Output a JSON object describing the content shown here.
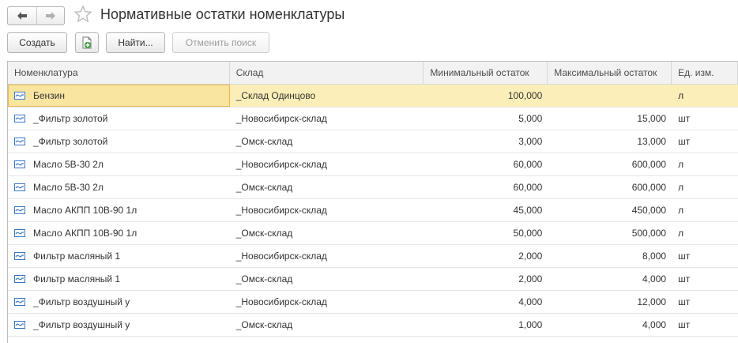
{
  "window": {
    "title": "Нормативные остатки номенклатуры"
  },
  "toolbar": {
    "create_label": "Создать",
    "find_label": "Найти...",
    "cancel_search_label": "Отменить поиск"
  },
  "table": {
    "columns": [
      "Номенклатура",
      "Склад",
      "Минимальный остаток",
      "Максимальный остаток",
      "Ед. изм."
    ],
    "rows": [
      {
        "name": "Бензин",
        "warehouse": "_Склад Одинцово",
        "min": "100,000",
        "max": "",
        "unit": "л",
        "selected": true
      },
      {
        "name": "_Фильтр золотой",
        "warehouse": "_Новосибирск-склад",
        "min": "5,000",
        "max": "15,000",
        "unit": "шт"
      },
      {
        "name": "_Фильтр золотой",
        "warehouse": "_Омск-склад",
        "min": "3,000",
        "max": "13,000",
        "unit": "шт"
      },
      {
        "name": "Масло 5В-30 2л",
        "warehouse": "_Новосибирск-склад",
        "min": "60,000",
        "max": "600,000",
        "unit": "л"
      },
      {
        "name": "Масло 5В-30 2л",
        "warehouse": "_Омск-склад",
        "min": "60,000",
        "max": "600,000",
        "unit": "л"
      },
      {
        "name": "Масло АКПП 10В-90 1л",
        "warehouse": "_Новосибирск-склад",
        "min": "45,000",
        "max": "450,000",
        "unit": "л"
      },
      {
        "name": "Масло АКПП 10В-90 1л",
        "warehouse": "_Омск-склад",
        "min": "50,000",
        "max": "500,000",
        "unit": "л"
      },
      {
        "name": "Фильтр масляный 1",
        "warehouse": "_Новосибирск-склад",
        "min": "2,000",
        "max": "8,000",
        "unit": "шт"
      },
      {
        "name": "Фильтр масляный 1",
        "warehouse": "_Омск-склад",
        "min": "2,000",
        "max": "4,000",
        "unit": "шт"
      },
      {
        "name": "_Фильтр воздушный у",
        "warehouse": "_Новосибирск-склад",
        "min": "4,000",
        "max": "12,000",
        "unit": "шт"
      },
      {
        "name": "_Фильтр воздушный у",
        "warehouse": "_Омск-склад",
        "min": "1,000",
        "max": "4,000",
        "unit": "шт"
      }
    ]
  },
  "colors": {
    "selected_row": "#fbeeb8",
    "selected_cell": "#f9e4a0",
    "header_bg": "#f2f2f2",
    "row_icon": "#3a78c2"
  },
  "icons": {
    "back": "arrow-left-icon",
    "forward": "arrow-right-icon",
    "favorite": "star-icon",
    "copy": "add-copy-icon",
    "row": "catalog-item-icon"
  }
}
